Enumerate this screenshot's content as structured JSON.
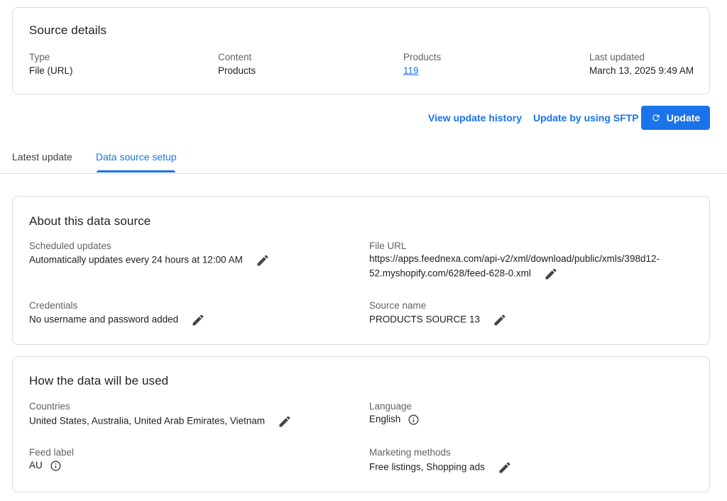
{
  "source_details": {
    "title": "Source details",
    "type_label": "Type",
    "type_value": "File (URL)",
    "content_label": "Content",
    "content_value": "Products",
    "products_label": "Products",
    "products_value": "119",
    "last_updated_label": "Last updated",
    "last_updated_value": "March 13, 2025 9:49 AM"
  },
  "actions": {
    "view_history": "View update history",
    "update_sftp": "Update by using SFTP",
    "update_button": "Update"
  },
  "tabs": [
    {
      "label": "Latest update",
      "active": false
    },
    {
      "label": "Data source setup",
      "active": true
    }
  ],
  "about": {
    "title": "About this data source",
    "scheduled_label": "Scheduled updates",
    "scheduled_value": "Automatically updates every 24 hours at 12:00 AM",
    "file_url_label": "File URL",
    "file_url_line1": "https://apps.feednexa.com/api-v2/xml/download/public/xmls/398d12-",
    "file_url_line2": "52.myshopify.com/628/feed-628-0.xml",
    "credentials_label": "Credentials",
    "credentials_value": "No username and password added",
    "source_name_label": "Source name",
    "source_name_value": "PRODUCTS SOURCE 13"
  },
  "usage": {
    "title": "How the data will be used",
    "countries_label": "Countries",
    "countries_value": "United States, Australia, United Arab Emirates, Vietnam",
    "language_label": "Language",
    "language_value": "English",
    "feed_label_label": "Feed label",
    "feed_label_value": "AU",
    "marketing_label": "Marketing methods",
    "marketing_value": "Free listings, Shopping ads"
  },
  "colors": {
    "accent": "#1a73e8",
    "text": "#202124",
    "muted": "#5f6368",
    "border": "#dadce0"
  },
  "icons": {
    "edit": "pencil-icon",
    "info": "info-icon",
    "refresh": "refresh-icon"
  }
}
